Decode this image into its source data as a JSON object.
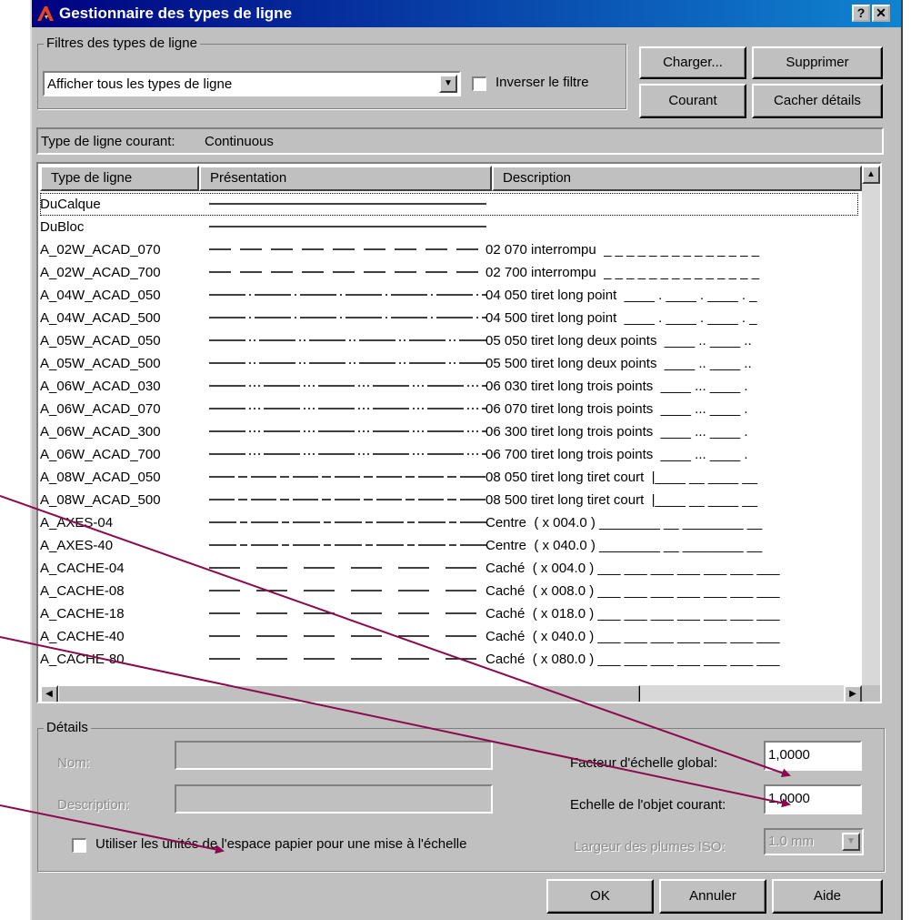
{
  "window": {
    "title": "Gestionnaire des types de ligne",
    "help_btn": "?",
    "close_btn": "✕"
  },
  "filters": {
    "group_label": "Filtres des types de ligne",
    "selected": "Afficher tous les types de ligne",
    "invert_label": "Inverser le filtre",
    "invert_checked": false
  },
  "buttons": {
    "load": "Charger...",
    "delete": "Supprimer",
    "current": "Courant",
    "hide_details": "Cacher détails",
    "ok": "OK",
    "cancel": "Annuler",
    "help": "Aide"
  },
  "current_linetype": {
    "label": "Type de ligne courant:",
    "value": "Continuous"
  },
  "list": {
    "columns": [
      "Type de ligne",
      "Présentation",
      "Description"
    ],
    "rows": [
      {
        "name": "DuCalque",
        "pattern": "solid",
        "description": ""
      },
      {
        "name": "DuBloc",
        "pattern": "solid",
        "description": ""
      },
      {
        "name": "A_02W_ACAD_070",
        "pattern": "dashed",
        "description": "02 070 interrompu  _ _ _ _ _ _ _ _ _ _ _ _ _ _"
      },
      {
        "name": "A_02W_ACAD_700",
        "pattern": "dashed",
        "description": "02 700 interrompu  _ _ _ _ _ _ _ _ _ _ _ _ _ _"
      },
      {
        "name": "A_04W_ACAD_050",
        "pattern": "dashdot",
        "description": "04 050 tiret long point  ____ . ____ . ____ . _"
      },
      {
        "name": "A_04W_ACAD_500",
        "pattern": "dashdot",
        "description": "04 500 tiret long point  ____ . ____ . ____ . _"
      },
      {
        "name": "A_05W_ACAD_050",
        "pattern": "dashdot2",
        "description": "05 050 tiret long deux points  ____ .. ____ .."
      },
      {
        "name": "A_05W_ACAD_500",
        "pattern": "dashdot2",
        "description": "05 500 tiret long deux points  ____ .. ____ .."
      },
      {
        "name": "A_06W_ACAD_030",
        "pattern": "dashdot3",
        "description": "06 030 tiret long trois points  ____ ... ____ ."
      },
      {
        "name": "A_06W_ACAD_070",
        "pattern": "dashdot3",
        "description": "06 070 tiret long trois points  ____ ... ____ ."
      },
      {
        "name": "A_06W_ACAD_300",
        "pattern": "dashdot3",
        "description": "06 300 tiret long trois points  ____ ... ____ ."
      },
      {
        "name": "A_06W_ACAD_700",
        "pattern": "dashdot3",
        "description": "06 700 tiret long trois points  ____ ... ____ ."
      },
      {
        "name": "A_08W_ACAD_050",
        "pattern": "dashshort",
        "description": "08 050 tiret long tiret court  |____ __ ____ __"
      },
      {
        "name": "A_08W_ACAD_500",
        "pattern": "dashshort",
        "description": "08 500 tiret long tiret court  |____ __ ____ __"
      },
      {
        "name": "A_AXES-04",
        "pattern": "center",
        "description": "Centre  ( x 004.0 ) ________ __ ________ __"
      },
      {
        "name": "A_AXES-40",
        "pattern": "center",
        "description": "Centre  ( x 040.0 ) ________ __ ________ __"
      },
      {
        "name": "A_CACHE-04",
        "pattern": "hidden",
        "description": "Caché  ( x 004.0 ) ___ ___ ___ ___ ___ ___ ___"
      },
      {
        "name": "A_CACHE-08",
        "pattern": "hidden",
        "description": "Caché  ( x 008.0 ) ___ ___ ___ ___ ___ ___ ___"
      },
      {
        "name": "A_CACHE-18",
        "pattern": "hidden",
        "description": "Caché  ( x 018.0 ) ___ ___ ___ ___ ___ ___ ___"
      },
      {
        "name": "A_CACHE-40",
        "pattern": "hidden",
        "description": "Caché  ( x 040.0 ) ___ ___ ___ ___ ___ ___ ___"
      },
      {
        "name": "A_CACHE-80",
        "pattern": "hidden",
        "description": "Caché  ( x 080.0 ) ___ ___ ___ ___ ___ ___ ___"
      }
    ]
  },
  "details": {
    "group_label": "Détails",
    "name_label": "Nom:",
    "name_value": "",
    "description_label": "Description:",
    "description_value": "",
    "global_scale_label": "Facteur d'échelle global:",
    "global_scale_value": "1,0000",
    "object_scale_label": "Echelle de l'objet courant:",
    "object_scale_value": "1,0000",
    "pen_width_label": "Largeur des plumes ISO:",
    "pen_width_value": "1.0 mm",
    "paper_units_label": "Utiliser les unités de l'espace papier pour une mise à l'échelle",
    "paper_units_checked": false
  },
  "annotation_color": "#8b0a4e"
}
